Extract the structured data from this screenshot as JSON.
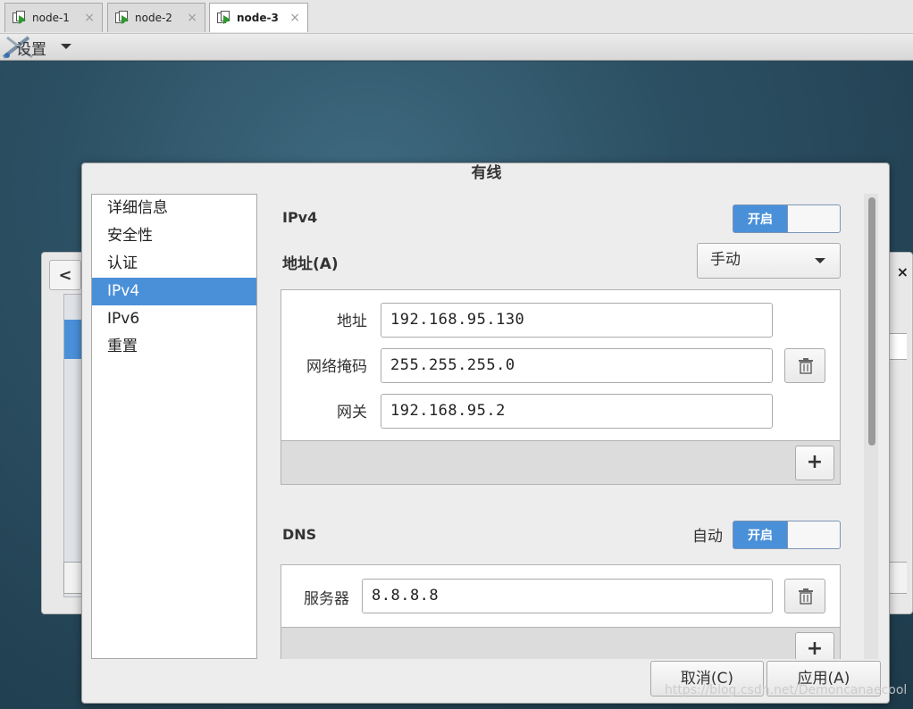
{
  "tabs": [
    {
      "label": "node-1",
      "close": "×"
    },
    {
      "label": "node-2",
      "close": "×"
    },
    {
      "label": "node-3",
      "close": "×",
      "active": true
    }
  ],
  "menu": {
    "settings_label": "设置"
  },
  "dialog": {
    "title": "有线",
    "nav": [
      "详细信息",
      "安全性",
      "认证",
      "IPv4",
      "IPv6",
      "重置"
    ],
    "nav_selected": "IPv4",
    "ipv4": {
      "section_label": "IPv4",
      "switch_label": "开启",
      "address_label": "地址(A)",
      "method_value": "手动",
      "rows": {
        "address_label": "地址",
        "address_value": "192.168.95.130",
        "netmask_label": "网络掩码",
        "netmask_value": "255.255.255.0",
        "gateway_label": "网关",
        "gateway_value": "192.168.95.2"
      },
      "add_label": "+"
    },
    "dns": {
      "section_label": "DNS",
      "auto_label": "自动",
      "switch_label": "开启",
      "server_label": "服务器",
      "server_value": "8.8.8.8",
      "add_label": "+"
    },
    "buttons": {
      "cancel": "取消(C)",
      "apply": "应用(A)"
    }
  },
  "background_window": {
    "back_label": "<",
    "close_label": "×",
    "btn_label": "+"
  },
  "watermark": "https://blog.csdn.net/Demoncanaecool",
  "colors": {
    "accent": "#4a90d9",
    "tab_play": "#2e9a2e"
  }
}
